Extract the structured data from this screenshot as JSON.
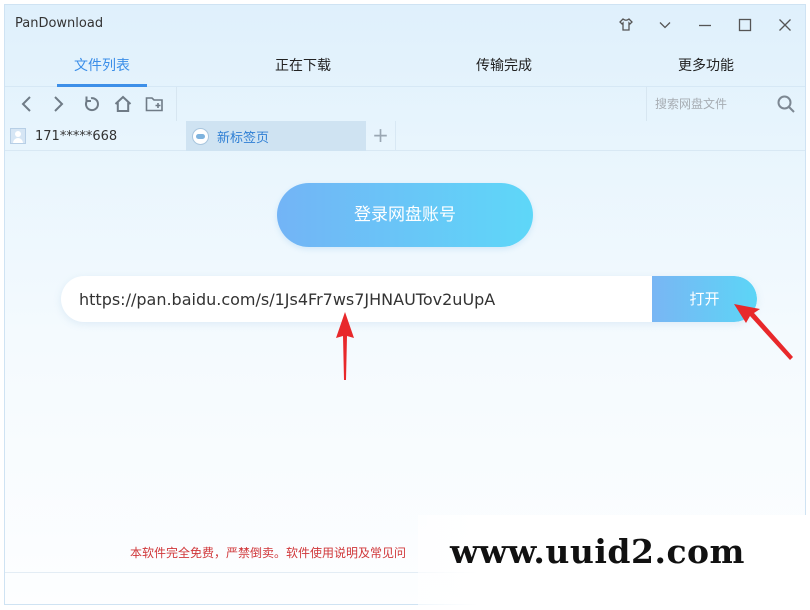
{
  "app": {
    "title": "PanDownload"
  },
  "window_controls": [
    "skin-icon",
    "dropdown-icon",
    "minimize-icon",
    "maximize-icon",
    "close-icon"
  ],
  "tabs": [
    {
      "label": "文件列表",
      "active": true
    },
    {
      "label": "正在下载",
      "active": false
    },
    {
      "label": "传输完成",
      "active": false
    },
    {
      "label": "更多功能",
      "active": false
    }
  ],
  "toolbar": {
    "icons": [
      "back-icon",
      "forward-icon",
      "refresh-icon",
      "home-icon",
      "new-folder-icon"
    ],
    "search_placeholder": "搜索网盘文件"
  },
  "account": {
    "name": "171*****668"
  },
  "page_tab": {
    "label": "新标签页",
    "add_label": "+"
  },
  "main": {
    "login_label": "登录网盘账号",
    "url_value": "https://pan.baidu.com/s/1Js4Fr7ws7JHNAUTov2uUpA",
    "open_label": "打开"
  },
  "footer": {
    "notice": "本软件完全免费，严禁倒卖。软件使用说明及常见问"
  },
  "watermark": "www.uuid2.com",
  "colors": {
    "accent": "#3d8fe8",
    "button_gradient_start": "#73b4f6",
    "button_gradient_end": "#5ed7f8",
    "notice_red": "#d0373a",
    "arrow_red": "#e8282b"
  }
}
